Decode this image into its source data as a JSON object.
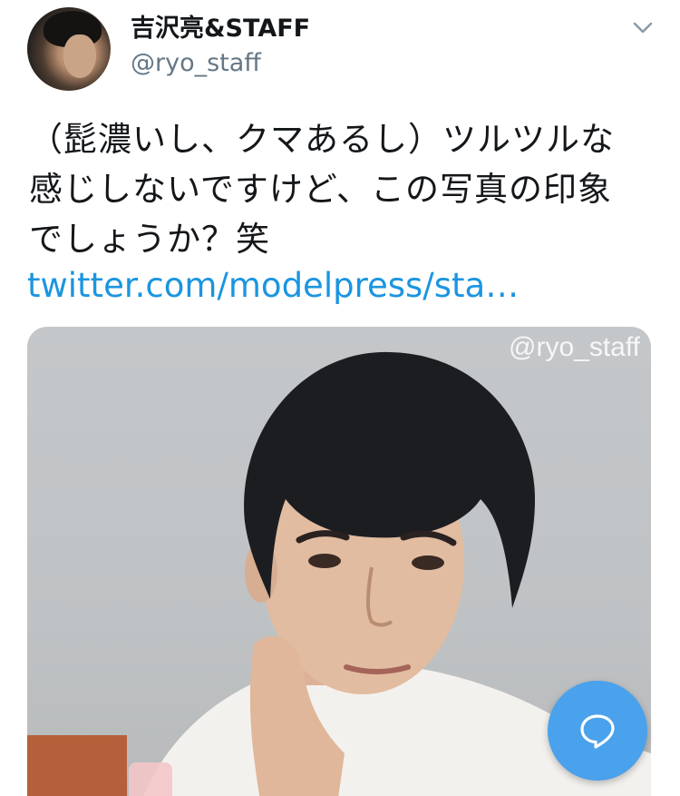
{
  "author": {
    "display_name": "吉沢亮&STAFF",
    "handle": "@ryo_staff",
    "avatar_icon": "profile-photo"
  },
  "header": {
    "more_icon": "chevron-down-icon"
  },
  "tweet": {
    "text_lines": [
      "（髭濃いし、クマあるし）ツルツルな",
      "感じしないですけど、この写真の印象",
      "でしょうか？笑"
    ],
    "link": "twitter.com/modelpress/sta…"
  },
  "media": {
    "watermark": "@ryo_staff"
  },
  "fab": {
    "icon": "compose-reply-icon",
    "color": "#4aa1ec"
  },
  "colors": {
    "link": "#1b95e0",
    "handle": "#657786",
    "text": "#14171a"
  }
}
